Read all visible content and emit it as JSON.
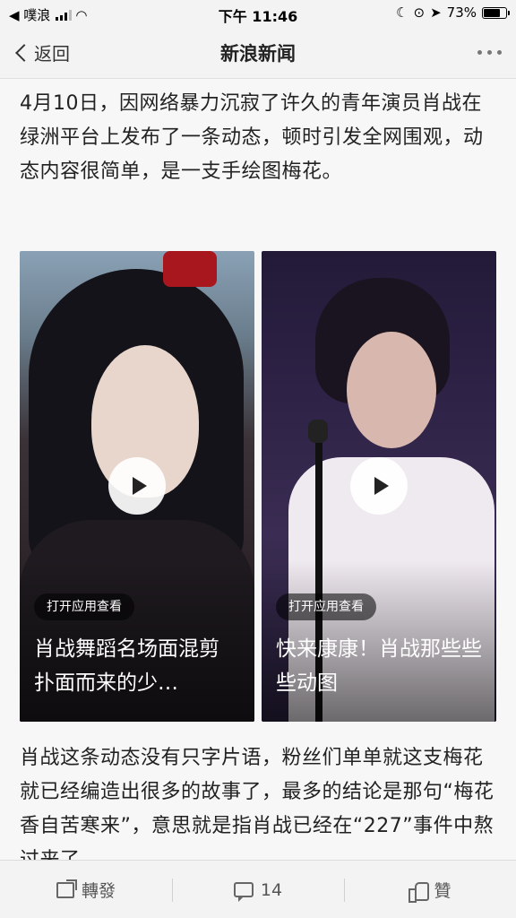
{
  "status_bar": {
    "carrier": "◀ 噗浪",
    "time": "下午 11:46",
    "battery": "73%",
    "battery_level": 0.73
  },
  "nav": {
    "back_label": "返回",
    "title": "新浪新闻"
  },
  "article": {
    "paragraph_1": "4月10日，因网络暴力沉寂了许久的青年演员肖战在绿洲平台上发布了一条动态，顿时引发全网围观，动态内容很简单，是一支手绘图梅花。",
    "paragraph_2": "肖战这条动态没有只字片语，粉丝们单单就这支梅花就已经编造出很多的故事了，最多的结论是那句“梅花香自苦寒来”，意思就是指肖战已经在“227”事件中熬过来了",
    "videos": [
      {
        "badge": "打开应用查看",
        "title": "肖战舞蹈名场面混剪 扑面而来的少…"
      },
      {
        "badge": "打开应用查看",
        "title": "快来康康！肖战那些些些动图"
      }
    ]
  },
  "bottom_bar": {
    "share_label": "轉發",
    "comment_count": "14",
    "like_label": "贊"
  }
}
